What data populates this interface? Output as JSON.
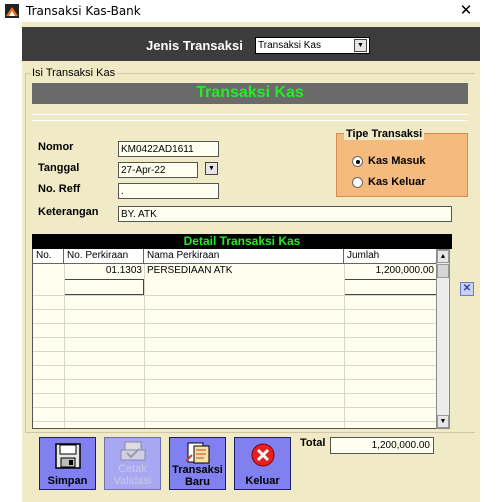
{
  "window": {
    "title": "Transaksi Kas-Bank",
    "close_symbol": "✕"
  },
  "header": {
    "jenis_label": "Jenis Transaksi",
    "jenis_value": "Transaksi Kas"
  },
  "group": {
    "label": "Isi Transaksi Kas",
    "title": "Transaksi Kas",
    "nomor_label": "Nomor",
    "nomor_value": "KM0422AD1611",
    "tanggal_label": "Tanggal",
    "tanggal_value": "27-Apr-22",
    "reff_label": "No. Reff",
    "reff_value": ".",
    "keterangan_label": "Keterangan",
    "keterangan_value": "BY. ATK"
  },
  "tipe": {
    "label": "Tipe Transaksi",
    "options": [
      {
        "label": "Kas Masuk",
        "selected": true
      },
      {
        "label": "Kas Keluar",
        "selected": false
      }
    ]
  },
  "detail": {
    "title": "Detail Transaksi Kas",
    "columns": [
      "No.",
      "No. Perkiraan",
      "Nama Perkiraan",
      "Jumlah"
    ],
    "rows": [
      {
        "no": "",
        "no_perkiraan": "01.1303",
        "nama": "PERSEDIAAN ATK",
        "jumlah": "1,200,000.00"
      }
    ]
  },
  "toolbar": {
    "simpan": "Simpan",
    "cetak": "Cetak Validasi",
    "baru": "Transaksi Baru",
    "keluar": "Keluar"
  },
  "total": {
    "label": "Total",
    "value": "1,200,000.00"
  },
  "colors": {
    "accent_green": "#22ee22",
    "panel_orange": "#f5bb7e",
    "button_blue": "#8080f0",
    "form_bg": "#f1eac6"
  }
}
